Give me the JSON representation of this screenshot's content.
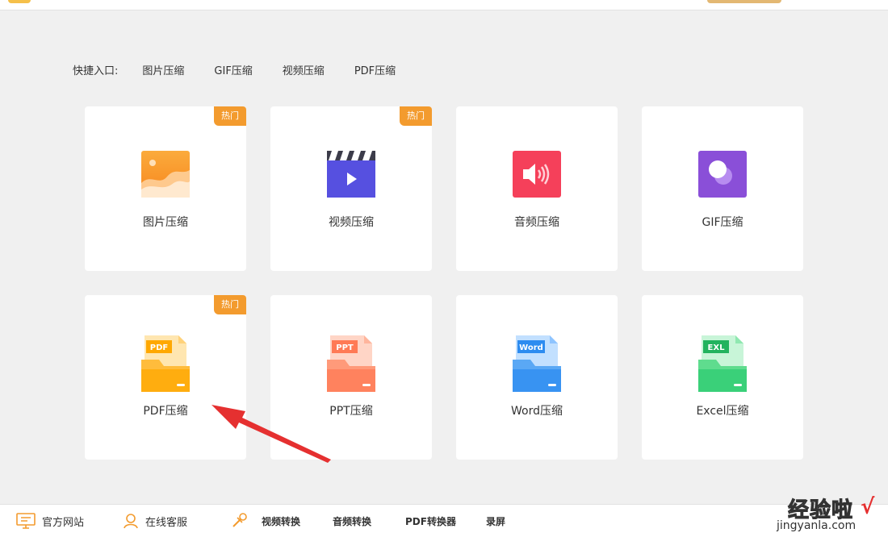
{
  "quick_entry": {
    "label": "快捷入口:",
    "links": [
      "图片压缩",
      "GIF压缩",
      "视频压缩",
      "PDF压缩"
    ]
  },
  "badge_hot": "热门",
  "cards": [
    {
      "label": "图片压缩",
      "icon": "image-icon",
      "hot": true
    },
    {
      "label": "视频压缩",
      "icon": "video-icon",
      "hot": true
    },
    {
      "label": "音频压缩",
      "icon": "audio-icon",
      "hot": false
    },
    {
      "label": "GIF压缩",
      "icon": "gif-icon",
      "hot": false
    },
    {
      "label": "PDF压缩",
      "icon": "pdf-folder-icon",
      "hot": true,
      "tag": "PDF"
    },
    {
      "label": "PPT压缩",
      "icon": "ppt-folder-icon",
      "hot": false,
      "tag": "PPT"
    },
    {
      "label": "Word压缩",
      "icon": "word-folder-icon",
      "hot": false,
      "tag": "Word"
    },
    {
      "label": "Excel压缩",
      "icon": "excel-folder-icon",
      "hot": false,
      "tag": "EXL"
    }
  ],
  "bottom_bar": {
    "website": "官方网站",
    "service": "在线客服",
    "video_convert": "视频转换",
    "audio_convert": "音频转换",
    "pdf_converter": "PDF转换器",
    "record": "录屏"
  },
  "watermark": {
    "main": "经验啦",
    "sub": "jingyanla.com",
    "check": "√"
  },
  "colors": {
    "hot_badge": "#f39b2e",
    "image": "#f7941d",
    "video": "#5650e0",
    "audio": "#f5405a",
    "gif": "#8a4fd8",
    "pdf": "#ffa800",
    "ppt": "#ff7a55",
    "word": "#2d8cf0",
    "excel": "#2ecc71",
    "arrow": "#e53030"
  }
}
